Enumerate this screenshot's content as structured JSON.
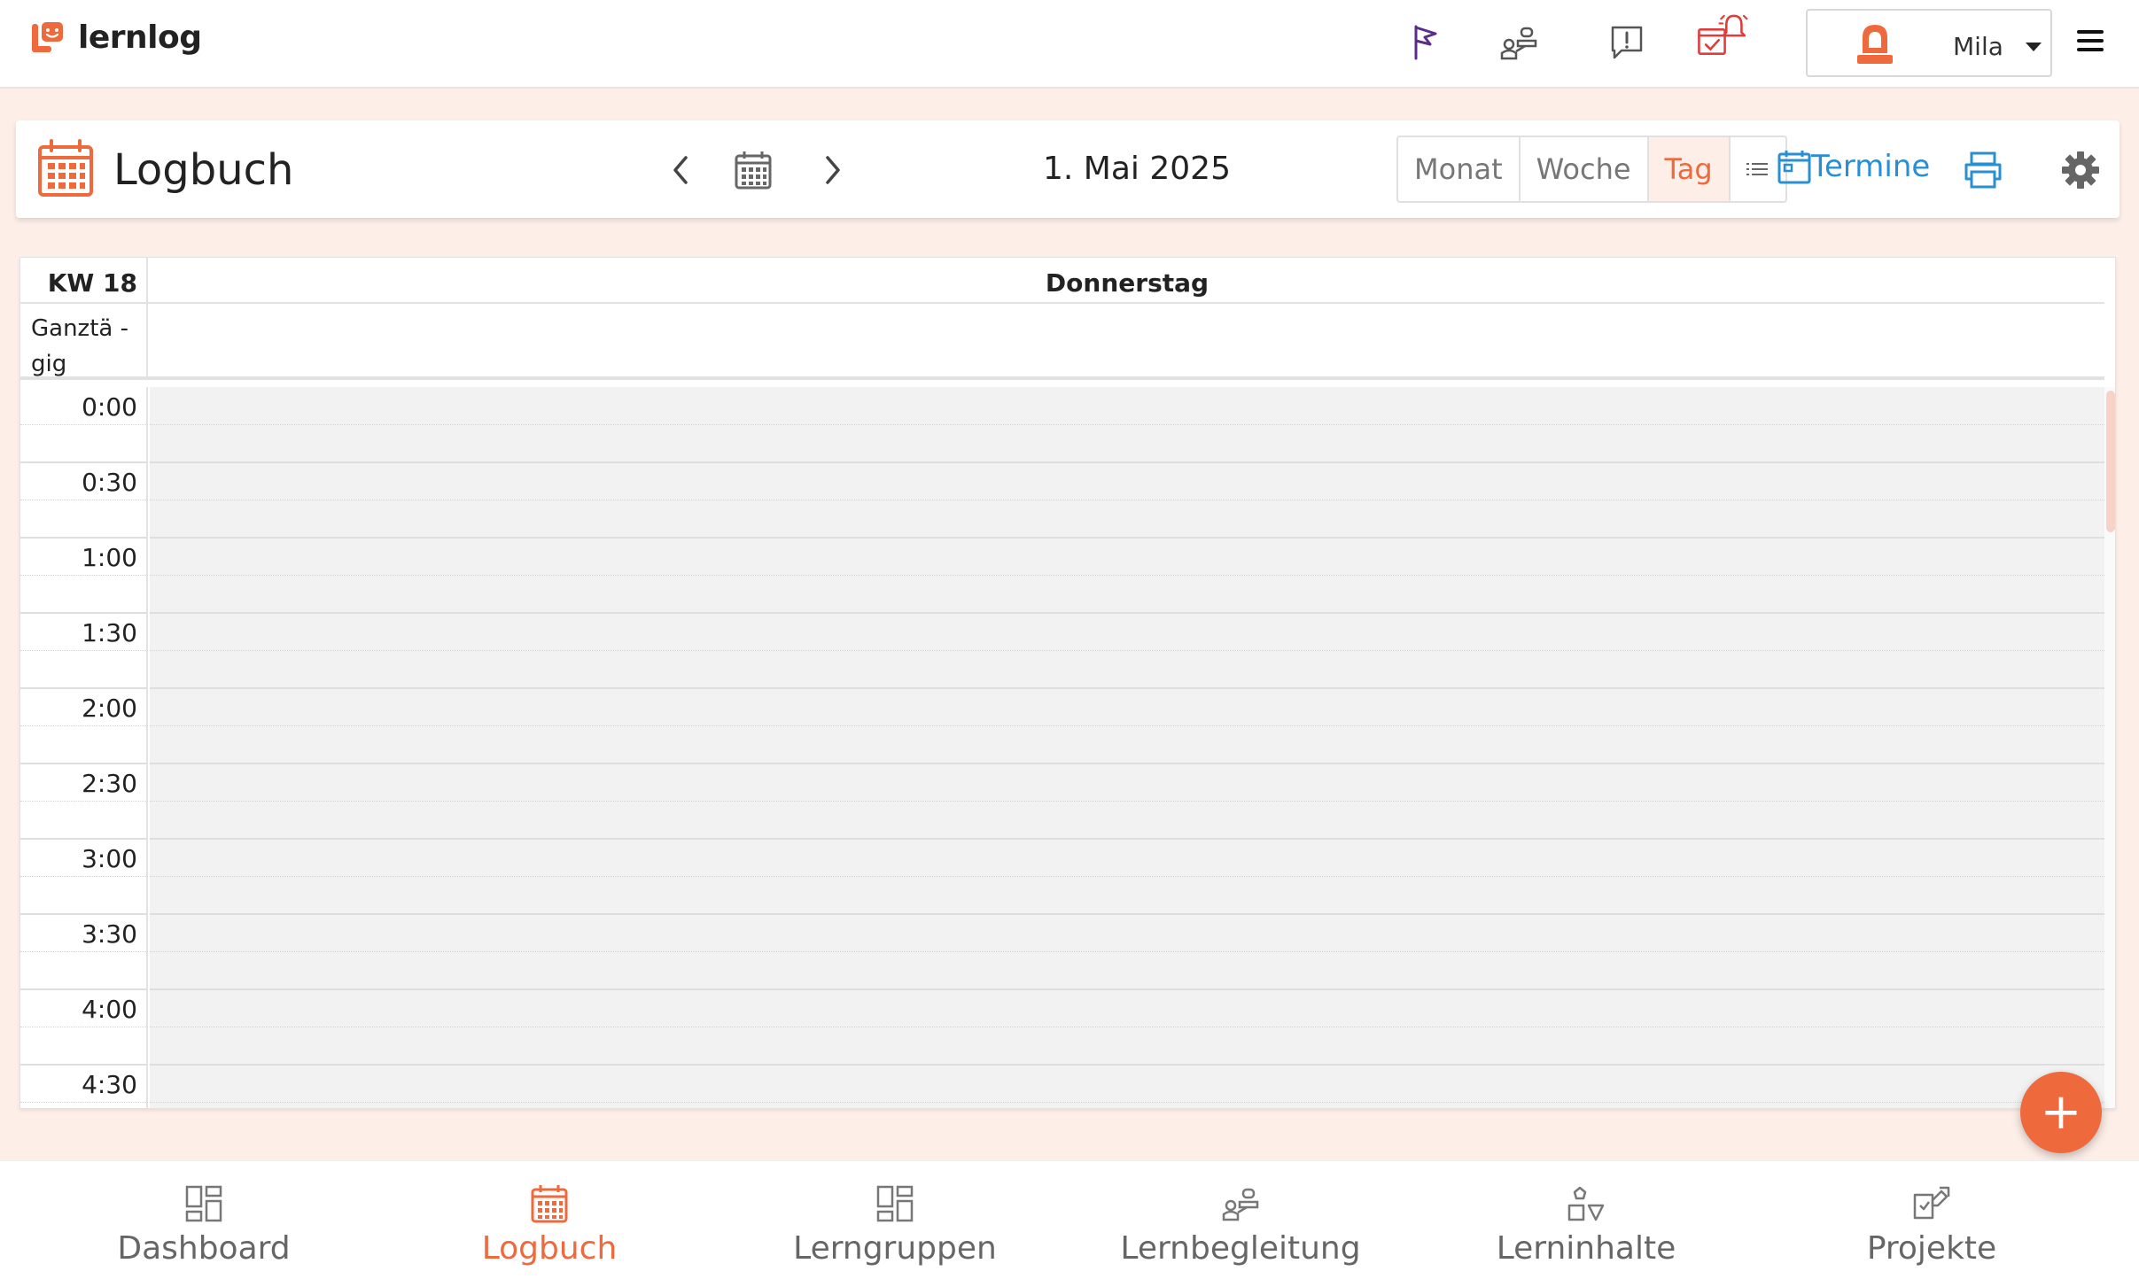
{
  "app": {
    "name": "lernlog"
  },
  "topbar": {
    "user_name": "Mila",
    "colors": {
      "flag": "#5b2d8a",
      "alarm": "#e33a3a",
      "avatar": "#ee6a3c"
    }
  },
  "header": {
    "title": "Logbuch",
    "date": "1. Mai 2025",
    "views": [
      {
        "label": "Monat",
        "active": false
      },
      {
        "label": "Woche",
        "active": false
      },
      {
        "label": "Tag",
        "active": true
      }
    ],
    "termine_label": "Termine"
  },
  "calendar": {
    "week_label": "KW 18",
    "day_name": "Donnerstag",
    "allday_label": "Ganztä - gig",
    "times": [
      "0:00",
      "0:30",
      "1:00",
      "1:30",
      "2:00",
      "2:30",
      "3:00",
      "3:30",
      "4:00",
      "4:30"
    ]
  },
  "fab": {
    "label": "+"
  },
  "bottom_nav": [
    {
      "label": "Dashboard",
      "icon": "dashboard-icon",
      "active": false
    },
    {
      "label": "Logbuch",
      "icon": "calendar-icon",
      "active": true
    },
    {
      "label": "Lerngruppen",
      "icon": "groups-icon",
      "active": false
    },
    {
      "label": "Lernbegleitung",
      "icon": "mentoring-icon",
      "active": false
    },
    {
      "label": "Lerninhalte",
      "icon": "content-shapes-icon",
      "active": false
    },
    {
      "label": "Projekte",
      "icon": "projects-icon",
      "active": false
    }
  ],
  "accent_color": "#ee6a3c",
  "link_color": "#2a8fd2"
}
